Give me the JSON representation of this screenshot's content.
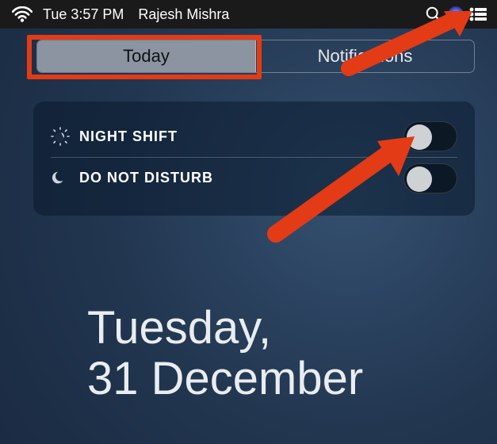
{
  "menubar": {
    "datetime": "Tue 3:57 PM",
    "user": "Rajesh Mishra"
  },
  "tabs": {
    "today": "Today",
    "notifications": "Notifications"
  },
  "settings": {
    "night_shift_label": "NIGHT SHIFT",
    "dnd_label": "DO NOT DISTURB"
  },
  "date": {
    "line1": "Tuesday,",
    "line2": "31 December"
  }
}
